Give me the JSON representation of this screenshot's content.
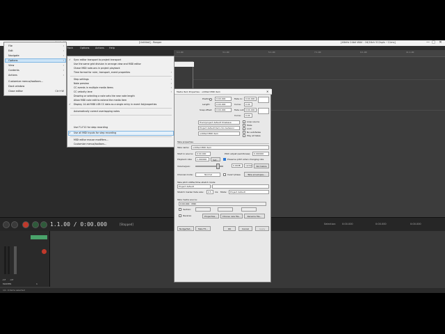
{
  "window": {
    "title_left": "[default]",
    "title_mid": "[Untitled] - Reaper",
    "title_right": "[48kHz 24bit WAV : 16/16ch 512spls ~11ms]",
    "close_glyph": "✕",
    "max_glyph": "□",
    "min_glyph": "—"
  },
  "menubar": {
    "items": [
      "Track",
      "Options",
      "Actions",
      "Help"
    ]
  },
  "ruler": {
    "ticks": [
      "1.1.00",
      "3.1.00",
      "5.1.00",
      "7.1.00",
      "9.1.00",
      "11.1.00"
    ]
  },
  "transport": {
    "time": "1.1.00 / 0:00.000",
    "status": "[Stopped]",
    "right_labels": [
      "Selection:",
      "0:00.000",
      "0:00.000",
      "0:00.000"
    ]
  },
  "left_menu": {
    "items": [
      {
        "label": "File",
        "arrow": "›"
      },
      {
        "label": "Edit",
        "arrow": "›"
      },
      {
        "label": "Navigate",
        "arrow": "›"
      },
      {
        "label": "Options",
        "arrow": "›",
        "highlight": true
      },
      {
        "label": "View",
        "arrow": "›"
      },
      {
        "label": "Contents",
        "arrow": "›"
      },
      {
        "label": "Actions",
        "arrow": "›"
      },
      {
        "label": "Customize menus/toolbars...",
        "arrow": ""
      },
      {
        "label": "Dock window",
        "arrow": ""
      },
      {
        "label": "Close editor",
        "arrow": "Ctrl+W"
      }
    ]
  },
  "options_submenu": {
    "items": [
      {
        "label": "Sync editor transport to project transport",
        "checked": true
      },
      {
        "label": "Use the same grid division in arrange view and MIDI editor",
        "checked": false
      },
      {
        "label": "Chase MIDI note-ons in project playback",
        "checked": false
      },
      {
        "label": "Time format for ruler, transport, event properties",
        "checked": false,
        "arrow": true
      },
      {
        "sep": true
      },
      {
        "label": "Step settings",
        "checked": false,
        "arrow": true
      },
      {
        "label": "Note preview",
        "checked": false,
        "arrow": true
      },
      {
        "label": "CC events in multiple media items",
        "checked": false,
        "arrow": true
      },
      {
        "label": "CC velocity lane",
        "checked": false,
        "arrow": true
      },
      {
        "label": "Drawing or selecting a note sets the new note length",
        "checked": false
      },
      {
        "label": "Allow MIDI note edit to extend the media item",
        "checked": false
      },
      {
        "label": "Display 14-bit MIDI LSB CC data as a single entry in event list/properties",
        "checked": true
      },
      {
        "sep": true
      },
      {
        "label": "Automatically correct overlapping notes",
        "checked": false
      },
      {
        "sep": true
      },
      {
        "label": "Use F1-F12 for step recording",
        "checked": false
      },
      {
        "label": "Use all MIDI inputs for step recording",
        "checked": true,
        "highlight": true
      },
      {
        "sep": true
      },
      {
        "label": "MIDI editor mouse modifiers...",
        "checked": false
      },
      {
        "label": "Customize menus/toolbars...",
        "checked": false
      }
    ],
    "check_glyph": "✓",
    "arrow_glyph": "›"
  },
  "midi_editor": {
    "title": "untitled MIDI item",
    "channels_label": "All channels"
  },
  "item_dialog": {
    "title": "Media Item Properties : untitled MIDI item",
    "position_label": "Position:",
    "position_value": "0:00.000",
    "length_label": "Length:",
    "length_value": "0:00.000",
    "snap_label": "Snap offset:",
    "snap_value": "0:00.000",
    "time_opt": "time",
    "beats_opt": "beats",
    "hmsf_opt": "H:M:S:F",
    "fade_in_label": "Fade in:",
    "fade_in_value": "0:00.000",
    "fade_out_label": "Fade out:",
    "fade_out_value": "0:00.000",
    "curve_label": "Curve:",
    "curve_value": "0.00",
    "track_tb_select": "Track/project default timebase",
    "fade_select": "Project default item mix behavior",
    "item_name": "untitled MIDI item",
    "loop_source": "Loop source",
    "mute": "Mute",
    "lock": "Lock",
    "no_autofades": "No autofades",
    "play_all_takes": "Play all takes",
    "take_props": "Take properties",
    "take_name_label": "Take name:",
    "take_name_value": "untitled MIDI item",
    "start_in_source_label": "Start in source:",
    "start_in_source_value": "0:00.000",
    "pitch_adjust_label": "Pitch adjust (semitones):",
    "pitch_adjust_value": "0.000000",
    "playback_rate_label": "Playback rate:",
    "playback_rate_value": "1.000000",
    "set_btn": "Set...",
    "preserve_pitch": "Preserve pitch when changing rate",
    "volume_pan_label": "Volume/pan:",
    "volume_value": "0.00dB",
    "pan_value": "center",
    "normalize_btn": "Normalize",
    "channel_mode_label": "Channel mode:",
    "channel_mode_value": "Normal",
    "invert_phase": "Invert phase",
    "take_envelopes_btn": "Take envelopes...",
    "pitch_shift_label": "Take pitch shifter/time stretch mode:",
    "pitch_shift_value": "Project default",
    "stretch_fade_label": "Stretch marker fade size:",
    "stretch_fade_value": "2.5",
    "ms_label": "ms",
    "mode_label": "Mode:",
    "mode_value": "Project default",
    "take_media_source": "Take media source:",
    "source_value": "0:00.000 : MIDI",
    "section_label": "Section:",
    "reverse_label": "Reverse",
    "properties_btn": "Properties...",
    "choose_new_file_btn": "Choose new file...",
    "rename_file_btn": "Rename file...",
    "nudge_btn": "Nudge/Set...",
    "take_fx_btn": "Take FX...",
    "ok_btn": "OK",
    "cancel_btn": "Cancel",
    "apply_btn": "Apply"
  },
  "mixer": {
    "master_label": "MASTER",
    "track_label": "1",
    "db_left": "-inf",
    "db_right": "-inf"
  },
  "statusbar": {
    "text": "1/1: 0 items selected"
  }
}
